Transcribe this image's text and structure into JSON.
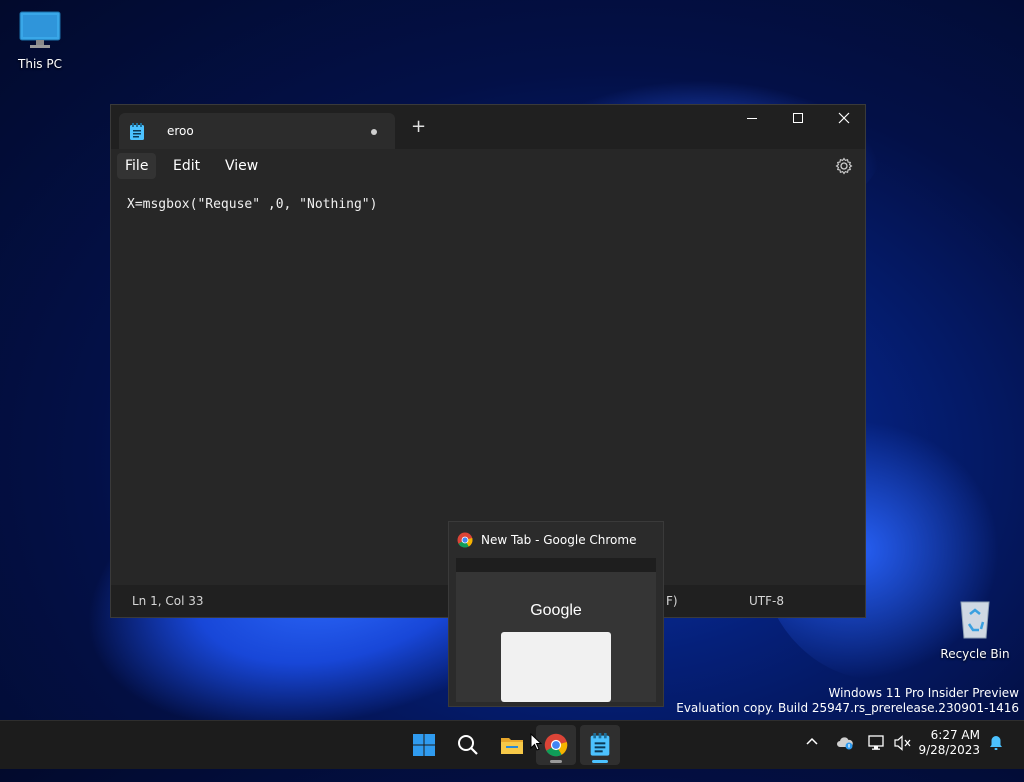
{
  "desktop": {
    "icons": [
      {
        "label": "This PC"
      },
      {
        "label": "Recycle Bin"
      }
    ],
    "watermark": {
      "line1": "Windows 11 Pro Insider Preview",
      "line2": "Evaluation copy. Build 25947.rs_prerelease.230901-1416"
    }
  },
  "notepad": {
    "tab_title": "eroo",
    "new_tab": "+",
    "menu": {
      "file": "File",
      "edit": "Edit",
      "view": "View"
    },
    "content": "X=msgbox(\"Requse\" ,0, \"Nothing\")",
    "status": {
      "position": "Ln 1, Col 33",
      "line_ending_partial": "F)",
      "encoding": "UTF-8"
    }
  },
  "chrome_preview": {
    "title": "New Tab - Google Chrome",
    "logo_text": "Google"
  },
  "taskbar": {
    "time": "6:27 AM",
    "date": "9/28/2023"
  },
  "colors": {
    "accent": "#4cc2ff",
    "window_bg": "#272727",
    "titlebar_bg": "#202020"
  }
}
